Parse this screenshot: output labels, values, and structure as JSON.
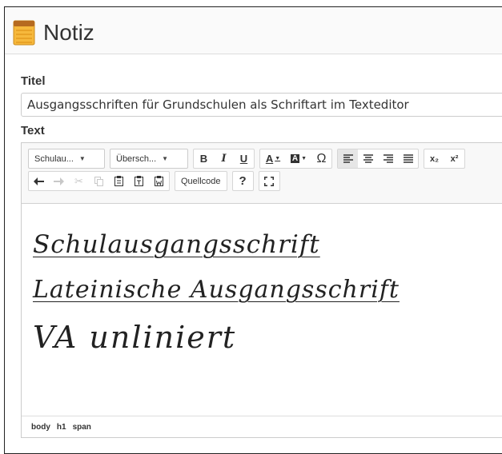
{
  "window": {
    "title": "Notiz",
    "icon": "notepad-icon"
  },
  "form": {
    "title_label": "Titel",
    "title_value": "Ausgangsschriften für Grundschulen als Schriftart im Texteditor",
    "text_label": "Text"
  },
  "toolbar": {
    "font_combo": "Schulau...",
    "heading_combo": "Übersch...",
    "bold": "B",
    "italic": "I",
    "underline": "U",
    "text_color": "A",
    "bg_color": "A",
    "special_char": "Ω",
    "subscript": "x₂",
    "superscript": "x²",
    "source": "Quellcode",
    "help": "?",
    "undo_icon": "undo-icon",
    "redo_icon": "redo-icon",
    "cut_icon": "cut-icon",
    "copy_icon": "copy-icon",
    "paste_icon": "paste-icon",
    "paste_text_icon": "paste-text-icon",
    "paste_word_icon": "paste-word-icon",
    "maximize_icon": "maximize-icon"
  },
  "editor": {
    "lines": [
      "Schulausgangsschrift",
      "Lateinische Ausgangsschrift",
      "VA unliniert"
    ]
  },
  "statusbar": {
    "path": [
      "body",
      "h1",
      "span"
    ]
  },
  "colors": {
    "accent_border": "#cccccc",
    "toolbar_bg": "#f8f8f8",
    "active_button": "#e6e6e6"
  }
}
